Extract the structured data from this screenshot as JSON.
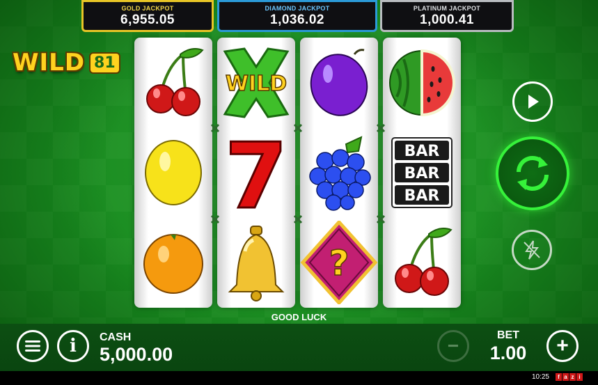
{
  "jackpots": {
    "gold": {
      "label": "GOLD JACKPOT",
      "value": "6,955.05"
    },
    "diamond": {
      "label": "DIAMOND JACKPOT",
      "value": "1,036.02"
    },
    "platinum": {
      "label": "PLATINUM JACKPOT",
      "value": "1,000.41"
    }
  },
  "logo": {
    "text": "WILD",
    "number": "81"
  },
  "reels": [
    [
      "cherries-icon",
      "lemon-icon",
      "orange-icon"
    ],
    [
      "wild-icon",
      "seven-icon",
      "bell-icon"
    ],
    [
      "plum-icon",
      "grapes-icon",
      "mystery-icon"
    ],
    [
      "watermelon-icon",
      "bar-icon",
      "cherries-icon"
    ]
  ],
  "wild_label": "WILD",
  "bar_label": "BAR",
  "mystery_label": "?",
  "seven_label": "7",
  "message": "GOOD LUCK",
  "cash": {
    "label": "CASH",
    "value": "5,000.00"
  },
  "bet": {
    "label": "BET",
    "value": "1.00"
  },
  "info_label": "i",
  "minus_label": "−",
  "plus_label": "+",
  "status": {
    "time": "10:25",
    "brand_letters": [
      "f",
      "a",
      "z",
      "i"
    ]
  },
  "colors": {
    "gold": "#e8c526",
    "diamond": "#2b9ad8",
    "platinum": "#b9bcc0",
    "spin_glow": "#36f23a",
    "table_green": "#1a8a20"
  }
}
